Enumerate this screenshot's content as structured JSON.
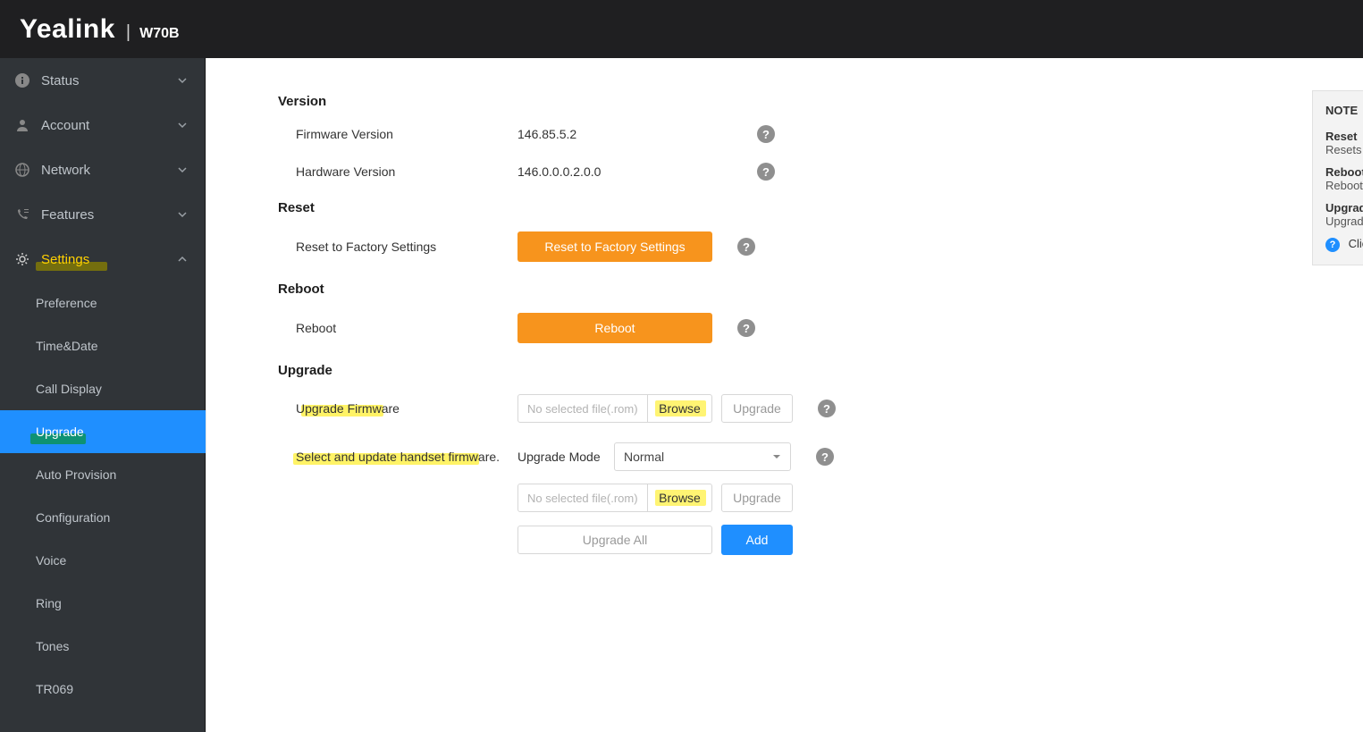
{
  "header": {
    "brand": "Yealink",
    "separator": "|",
    "model": "W70B"
  },
  "sidebar": {
    "items": [
      {
        "label": "Status"
      },
      {
        "label": "Account"
      },
      {
        "label": "Network"
      },
      {
        "label": "Features"
      },
      {
        "label": "Settings"
      }
    ],
    "settings_children": [
      {
        "label": "Preference"
      },
      {
        "label": "Time&Date"
      },
      {
        "label": "Call Display"
      },
      {
        "label": "Upgrade"
      },
      {
        "label": "Auto Provision"
      },
      {
        "label": "Configuration"
      },
      {
        "label": "Voice"
      },
      {
        "label": "Ring"
      },
      {
        "label": "Tones"
      },
      {
        "label": "TR069"
      }
    ]
  },
  "page": {
    "version": {
      "title": "Version",
      "firmware_label": "Firmware Version",
      "firmware_value": "146.85.5.2",
      "hardware_label": "Hardware Version",
      "hardware_value": "146.0.0.0.2.0.0"
    },
    "reset": {
      "title": "Reset",
      "label": "Reset to Factory Settings",
      "button": "Reset to Factory Settings"
    },
    "reboot": {
      "title": "Reboot",
      "label": "Reboot",
      "button": "Reboot"
    },
    "upgrade": {
      "title": "Upgrade",
      "firmware_label": "Upgrade Firmware",
      "file_placeholder": "No selected file(.rom)",
      "browse": "Browse",
      "upgrade_btn": "Upgrade",
      "handset_label": "Select and update handset firmware.",
      "mode_label": "Upgrade Mode",
      "mode_value": "Normal",
      "upgrade_all": "Upgrade All",
      "add": "Add"
    }
  },
  "notes": {
    "title": "NOTE",
    "reset_head": "Reset",
    "reset_body": "Resets",
    "reboot_head": "Reboot",
    "reboot_body": "Reboot",
    "upgrade_head": "Upgrade",
    "upgrade_body": "Upgrade",
    "click": "Click"
  }
}
